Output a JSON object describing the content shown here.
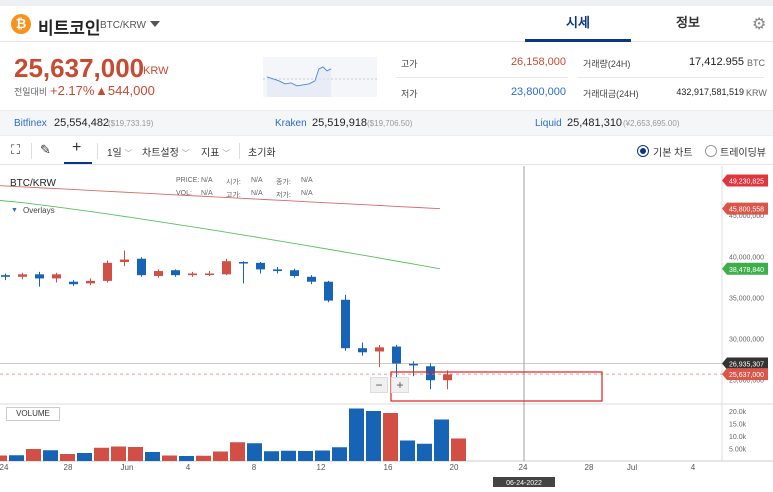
{
  "header": {
    "coin_icon": "bitcoin-icon",
    "coin_name": "비트코인",
    "pair": "BTC/KRW",
    "tabs": [
      "시세",
      "정보"
    ],
    "settings_icon": "gear-icon"
  },
  "price": {
    "current": "25,637,000",
    "unit": "KRW",
    "compare_label": "전일대비",
    "change_pct": "+2.17%",
    "change_amt": "▲544,000",
    "high_label": "고가",
    "high": "26,158,000",
    "low_label": "저가",
    "low": "23,800,000",
    "vol_label": "거래량(24H)",
    "vol": "17,412.955",
    "vol_unit": "BTC",
    "amt_label": "거래대금(24H)",
    "amt": "432,917,581,519",
    "amt_unit": "KRW"
  },
  "exchanges": [
    {
      "name": "Bitfinex",
      "value": "25,554,482",
      "usd": "($19,733.19)"
    },
    {
      "name": "Kraken",
      "value": "25,519,918",
      "usd": "($19,706.50)"
    },
    {
      "name": "Liquid",
      "value": "25,481,310",
      "usd": "(¥2,653,695.00)"
    }
  ],
  "toolbar": {
    "interval": "1일",
    "chart_settings": "차트설정",
    "indicators": "지표",
    "reset": "초기화",
    "basic_chart": "기본 차트",
    "trading_view": "트레이딩뷰"
  },
  "chart_legend": {
    "pair": "BTC/KRW",
    "price_label": "PRICE:",
    "price_val": "N/A",
    "open_label": "시가:",
    "open_val": "N/A",
    "close_label": "종가:",
    "close_val": "N/A",
    "vol_label": "VOL:",
    "vol_val": "N/A",
    "high_label": "고가:",
    "high_val": "N/A",
    "low_label": "저가:",
    "low_val": "N/A",
    "overlays": "Overlays",
    "volume": "VOLUME"
  },
  "chart_data": {
    "type": "candlestick",
    "x_ticks": [
      "24",
      "28",
      "Jun",
      "4",
      "8",
      "12",
      "16",
      "20",
      "24",
      "28",
      "Jul",
      "4"
    ],
    "crosshair_date": "06-24-2022",
    "y_ticks": [
      "45,000,000",
      "40,000,000",
      "35,000,000",
      "30,000,000",
      "25,000,000"
    ],
    "y_range": [
      22000000,
      51000000
    ],
    "price_tags": [
      {
        "label": "49,230,825",
        "value": 49230825,
        "color": "#e0353c"
      },
      {
        "label": "45,800,558",
        "value": 45800558,
        "color": "#d9574a"
      },
      {
        "label": "38,478,840",
        "value": 38478840,
        "color": "#3dae4a"
      },
      {
        "label": "26,935,307",
        "value": 26935307,
        "color": "#333333"
      },
      {
        "label": "25,637,000",
        "value": 25637000,
        "color": "#d9574a"
      }
    ],
    "candles": [
      {
        "o": 37700000,
        "c": 37500000,
        "h": 37900000,
        "l": 37100000
      },
      {
        "o": 37500000,
        "c": 37800000,
        "h": 38000000,
        "l": 37200000
      },
      {
        "o": 37800000,
        "c": 37300000,
        "h": 38100000,
        "l": 36300000
      },
      {
        "o": 37300000,
        "c": 37800000,
        "h": 38000000,
        "l": 36800000
      },
      {
        "o": 36900000,
        "c": 36600000,
        "h": 37100000,
        "l": 36400000
      },
      {
        "o": 36700000,
        "c": 37000000,
        "h": 37300000,
        "l": 36500000
      },
      {
        "o": 37000000,
        "c": 39200000,
        "h": 39500000,
        "l": 36800000
      },
      {
        "o": 39300000,
        "c": 39600000,
        "h": 40700000,
        "l": 38800000
      },
      {
        "o": 39700000,
        "c": 37700000,
        "h": 39900000,
        "l": 37500000
      },
      {
        "o": 37600000,
        "c": 38200000,
        "h": 38400000,
        "l": 37400000
      },
      {
        "o": 38300000,
        "c": 37700000,
        "h": 38400000,
        "l": 37500000
      },
      {
        "o": 37700000,
        "c": 37900000,
        "h": 38100000,
        "l": 37500000
      },
      {
        "o": 37800000,
        "c": 37900000,
        "h": 38200000,
        "l": 37600000
      },
      {
        "o": 37800000,
        "c": 39400000,
        "h": 39700000,
        "l": 37700000
      },
      {
        "o": 39300000,
        "c": 39200000,
        "h": 39400000,
        "l": 36700000
      },
      {
        "o": 39200000,
        "c": 38400000,
        "h": 39300000,
        "l": 37900000
      },
      {
        "o": 38400000,
        "c": 38200000,
        "h": 38700000,
        "l": 37900000
      },
      {
        "o": 38300000,
        "c": 37600000,
        "h": 38500000,
        "l": 37400000
      },
      {
        "o": 37500000,
        "c": 36900000,
        "h": 37700000,
        "l": 36600000
      },
      {
        "o": 36900000,
        "c": 34600000,
        "h": 37000000,
        "l": 34400000
      },
      {
        "o": 34700000,
        "c": 28800000,
        "h": 35300000,
        "l": 28500000
      },
      {
        "o": 28800000,
        "c": 28300000,
        "h": 29500000,
        "l": 27900000
      },
      {
        "o": 28400000,
        "c": 28900000,
        "h": 29200000,
        "l": 26500000
      },
      {
        "o": 29000000,
        "c": 26900000,
        "h": 29200000,
        "l": 25000000
      },
      {
        "o": 26900000,
        "c": 26700000,
        "h": 27200000,
        "l": 25400000
      },
      {
        "o": 26600000,
        "c": 24900000,
        "h": 27000000,
        "l": 23800000
      },
      {
        "o": 24900000,
        "c": 25600000,
        "h": 26100000,
        "l": 23800000
      }
    ],
    "volume_ticks": [
      "20.0k",
      "15.0k",
      "10.0k",
      "5.00k"
    ],
    "volume": [
      2200,
      2300,
      4800,
      4300,
      2800,
      3200,
      5300,
      5800,
      5600,
      3600,
      2200,
      2000,
      2100,
      3800,
      7500,
      7100,
      3900,
      4100,
      4000,
      4200,
      5500,
      21000,
      20000,
      19200,
      8200,
      6900,
      16600,
      9000
    ],
    "ma_long": [
      [
        48600000,
        0
      ],
      [
        45800558,
        1
      ]
    ],
    "ma_mid": [
      [
        46800000,
        0
      ],
      [
        38478840,
        1
      ]
    ]
  }
}
